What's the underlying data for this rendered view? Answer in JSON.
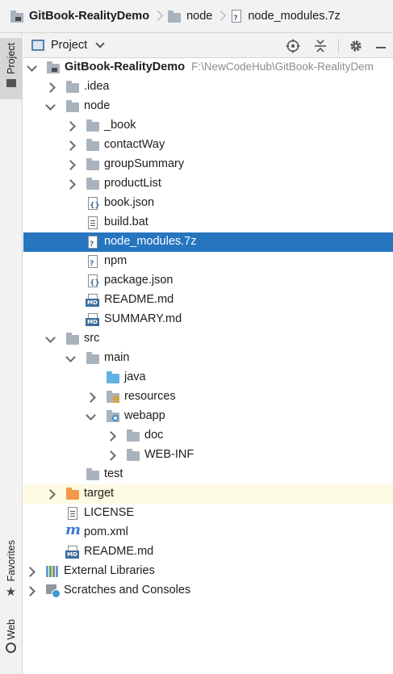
{
  "breadcrumb": {
    "items": [
      {
        "label": "GitBook-RealityDemo",
        "icon": "module-folder-icon"
      },
      {
        "label": "node",
        "icon": "folder-icon"
      },
      {
        "label": "node_modules.7z",
        "icon": "unknown-file-icon"
      }
    ]
  },
  "side_strip": {
    "project_tab": "Project",
    "favorites_tab": "Favorites",
    "web_tab": "Web"
  },
  "project_panel": {
    "title": "Project"
  },
  "tree": [
    {
      "label": "GitBook-RealityDemo",
      "path": "F:\\NewCodeHub\\GitBook-RealityDem",
      "icon": "module-folder-icon"
    },
    {
      "label": ".idea",
      "icon": "folder-icon"
    },
    {
      "label": "node",
      "icon": "folder-icon"
    },
    {
      "label": "_book",
      "icon": "folder-icon"
    },
    {
      "label": "contactWay",
      "icon": "folder-icon"
    },
    {
      "label": "groupSummary",
      "icon": "folder-icon"
    },
    {
      "label": "productList",
      "icon": "folder-icon"
    },
    {
      "label": "book.json",
      "icon": "json-file-icon"
    },
    {
      "label": "build.bat",
      "icon": "text-file-icon"
    },
    {
      "label": "node_modules.7z",
      "icon": "unknown-file-icon"
    },
    {
      "label": "npm",
      "icon": "unknown-file-icon"
    },
    {
      "label": "package.json",
      "icon": "json-file-icon"
    },
    {
      "label": "README.md",
      "icon": "markdown-file-icon"
    },
    {
      "label": "SUMMARY.md",
      "icon": "markdown-file-icon"
    },
    {
      "label": "src",
      "icon": "folder-icon"
    },
    {
      "label": "main",
      "icon": "folder-icon"
    },
    {
      "label": "java",
      "icon": "source-folder-icon"
    },
    {
      "label": "resources",
      "icon": "resources-folder-icon"
    },
    {
      "label": "webapp",
      "icon": "web-folder-icon"
    },
    {
      "label": "doc",
      "icon": "folder-icon"
    },
    {
      "label": "WEB-INF",
      "icon": "folder-icon"
    },
    {
      "label": "test",
      "icon": "folder-icon"
    },
    {
      "label": "target",
      "icon": "excluded-folder-icon"
    },
    {
      "label": "LICENSE",
      "icon": "text-file-icon"
    },
    {
      "label": "pom.xml",
      "icon": "maven-file-icon"
    },
    {
      "label": "README.md",
      "icon": "markdown-file-icon"
    },
    {
      "label": "External Libraries",
      "icon": "libraries-icon"
    },
    {
      "label": "Scratches and Consoles",
      "icon": "scratches-icon"
    }
  ],
  "colors": {
    "selection": "#2675bf",
    "folder": "#a9b3bd",
    "source_folder": "#62b1e3",
    "excluded_folder": "#f2994a",
    "excluded_row": "#fdfbe1"
  }
}
